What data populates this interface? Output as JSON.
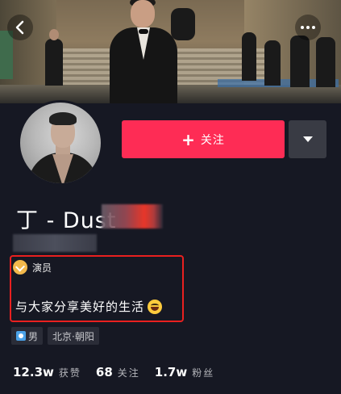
{
  "cover": {
    "photo": "cover-photo"
  },
  "header": {
    "back_icon": "chevron-left-icon",
    "more_icon": "more-horizontal-icon"
  },
  "profile": {
    "name_visible": "丁 - Dust",
    "follow_label": "关注",
    "follow_plus": "+",
    "dropdown_icon": "caret-down-icon",
    "badge_label": "演员",
    "badge_icon": "verified-badge-icon",
    "signature": "与大家分享美好的生活",
    "signature_emoji": "grinning-emoji"
  },
  "tags": {
    "gender": "男",
    "location": "北京·朝阳"
  },
  "stats": [
    {
      "value": "12.3w",
      "label": "获赞"
    },
    {
      "value": "68",
      "label": "关注"
    },
    {
      "value": "1.7w",
      "label": "粉丝"
    }
  ],
  "colors": {
    "background": "#161823",
    "follow": "#fe2c55",
    "highlight_border": "#e9201f"
  }
}
